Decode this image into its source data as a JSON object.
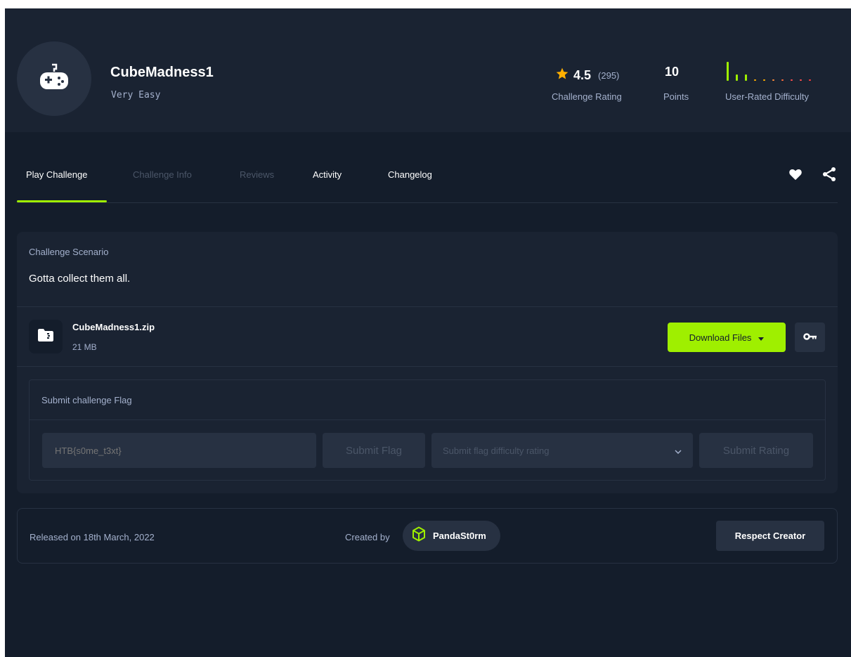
{
  "challenge": {
    "title": "CubeMadness1",
    "difficulty": "Very Easy",
    "rating_value": "4.5",
    "rating_count": "(295)",
    "rating_label": "Challenge Rating",
    "points_value": "10",
    "points_label": "Points",
    "user_difficulty_label": "User-Rated Difficulty",
    "user_difficulty_levels": [
      0.9,
      0.3,
      0.3,
      0.05,
      0.05,
      0.05,
      0.05,
      0.05,
      0.05,
      0.05
    ],
    "difficulty_colors": [
      "#9fef00",
      "#9fef00",
      "#9fef00",
      "#ffaf00",
      "#ffaf00",
      "#ff8c3a",
      "#ff6b3a",
      "#ff4e4e",
      "#ff4e4e",
      "#ff3e3e"
    ]
  },
  "tabs": [
    {
      "label": "Play Challenge",
      "active": true
    },
    {
      "label": "Challenge Info",
      "active": false
    },
    {
      "label": "Reviews",
      "active": false
    },
    {
      "label": "Activity",
      "active": false
    },
    {
      "label": "Changelog",
      "active": false
    }
  ],
  "scenario": {
    "label": "Challenge Scenario",
    "text": "Gotta collect them all."
  },
  "file": {
    "name": "CubeMadness1.zip",
    "size": "21 MB",
    "download_label": "Download Files"
  },
  "flag": {
    "label": "Submit challenge Flag",
    "input_placeholder": "HTB{s0me_t3xt}",
    "submit_label": "Submit Flag",
    "rating_placeholder": "Submit flag difficulty rating",
    "submit_rating_label": "Submit Rating"
  },
  "footer": {
    "released": "Released on 18th March, 2022",
    "created_by": "Created by",
    "creator": "PandaSt0rm",
    "respect_label": "Respect Creator"
  },
  "colors": {
    "accent": "#9fef00",
    "star": "#ffaf00",
    "background": "#141d2b",
    "panel": "#1a2332"
  }
}
